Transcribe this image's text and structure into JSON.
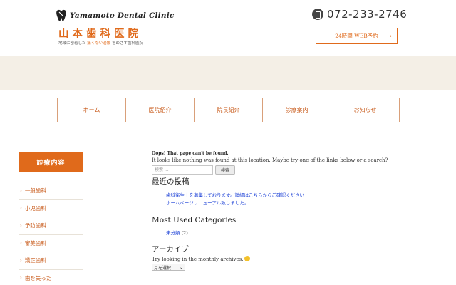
{
  "header": {
    "logo_script": "Yamamoto Dental Clinic",
    "clinic_name": "山本歯科医院",
    "tagline_before": "地域に密着した",
    "tagline_accent": "痛くない治療",
    "tagline_after": "をめざす歯科医院",
    "phone": "072-233-2746",
    "web_reserve_label": "24時間 WEB予約",
    "accent_color": "#e06a1b"
  },
  "nav": {
    "items": [
      "ホーム",
      "医院紹介",
      "院長紹介",
      "診療案内",
      "お知らせ"
    ]
  },
  "sidebar": {
    "title": "診療内容",
    "items": [
      "一般歯科",
      "小児歯科",
      "予防歯科",
      "審美歯科",
      "矯正歯科",
      "歯を失った"
    ]
  },
  "main": {
    "error_title": "Oops! That page can't be found.",
    "error_message": "It looks like nothing was found at this location. Maybe try one of the links below or a search?",
    "search_placeholder": "検索 ...",
    "search_button": "検索",
    "recent_heading": "最近の投稿",
    "recent_posts": [
      "歯科衛生士を募集しております。詳細はこちらからご確認ください",
      "ホームページリニューアル致しました。"
    ],
    "categories_heading": "Most Used Categories",
    "categories": [
      {
        "name": "未分類",
        "count": "(2)"
      }
    ],
    "archives_heading": "アーカイブ",
    "archives_desc": "Try looking in the monthly archives.",
    "archives_select": "月を選択"
  }
}
